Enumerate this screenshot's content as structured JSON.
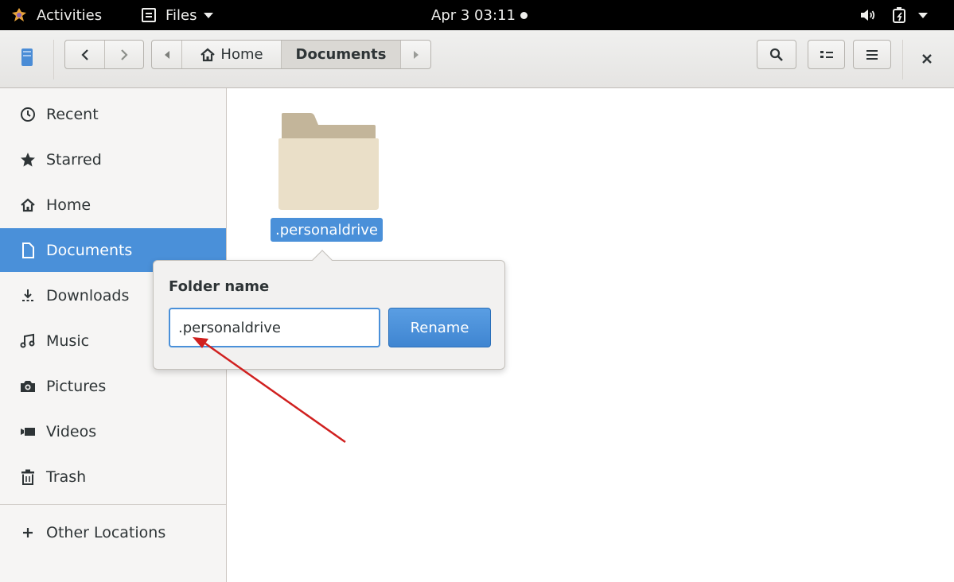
{
  "topbar": {
    "activities_label": "Activities",
    "app_label": "Files",
    "clock": "Apr 3  03:11",
    "icons": [
      "activities-logo-icon",
      "files-app-icon",
      "volume-icon",
      "power-icon"
    ]
  },
  "headerbar": {
    "path": {
      "home_label": "Home",
      "current_label": "Documents"
    },
    "icons": [
      "bookmark-icon",
      "back-icon",
      "forward-icon",
      "search-icon",
      "view-toggle-icon",
      "menu-icon",
      "close-icon"
    ]
  },
  "sidebar": {
    "items": [
      {
        "label": "Recent",
        "icon": "clock-icon"
      },
      {
        "label": "Starred",
        "icon": "star-icon"
      },
      {
        "label": "Home",
        "icon": "home-icon"
      },
      {
        "label": "Documents",
        "icon": "document-icon",
        "active": true
      },
      {
        "label": "Downloads",
        "icon": "download-icon"
      },
      {
        "label": "Music",
        "icon": "music-icon"
      },
      {
        "label": "Pictures",
        "icon": "camera-icon"
      },
      {
        "label": "Videos",
        "icon": "video-icon"
      },
      {
        "label": "Trash",
        "icon": "trash-icon"
      }
    ],
    "other_locations": "Other Locations"
  },
  "content": {
    "folder_name": ".personaldrive"
  },
  "popover": {
    "title": "Folder name",
    "input_value": ".personaldrive",
    "button_label": "Rename"
  },
  "colors": {
    "accent": "#4a90d9",
    "annotation_arrow": "#d0201f",
    "folder_tab": "#c3b59a",
    "folder_body": "#eadfc8"
  }
}
